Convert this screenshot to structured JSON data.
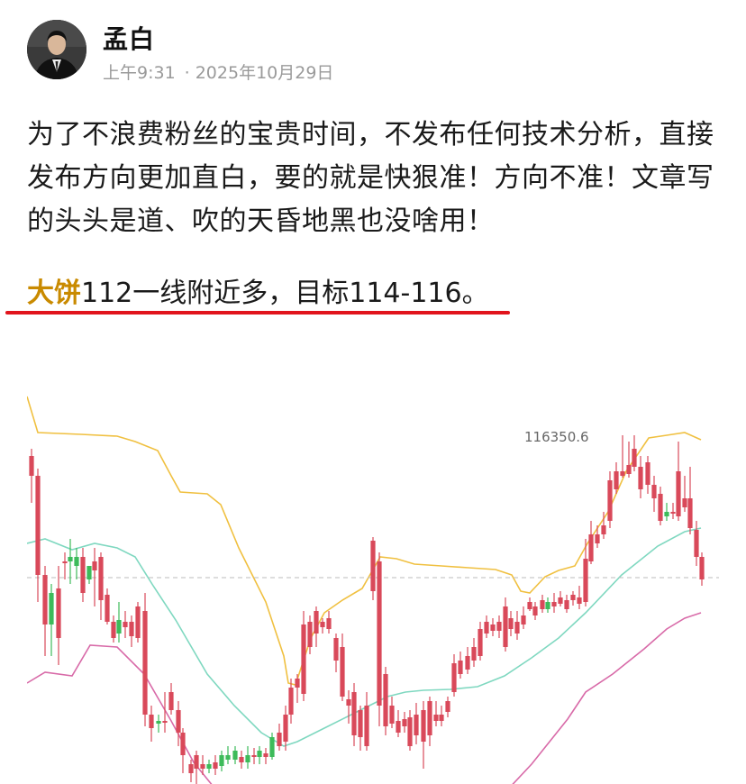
{
  "author": {
    "name": "孟白",
    "time": "上午9:31",
    "separator": "·",
    "date": "2025年10月29日"
  },
  "post": {
    "body": "为了不浪费粉丝的宝贵时间，不发布任何技术分析，直接发布方向更加直白，要的就是快狠准！方向不准！文章写的头头是道、吹的天昏地黑也没啥用！",
    "highlight_tag": "大饼",
    "highlight_rest": "112一线附近多，目标114-116。"
  },
  "chart_data": {
    "type": "candlestick",
    "peak_label": "116350.6",
    "colors": {
      "up": "#3dbb5a",
      "down": "#d9495a",
      "upper_band": "#f0c040",
      "middle_band": "#7fd8c0",
      "lower_band": "#d86aa8",
      "last_price_line": "#bbbbbb"
    }
  }
}
